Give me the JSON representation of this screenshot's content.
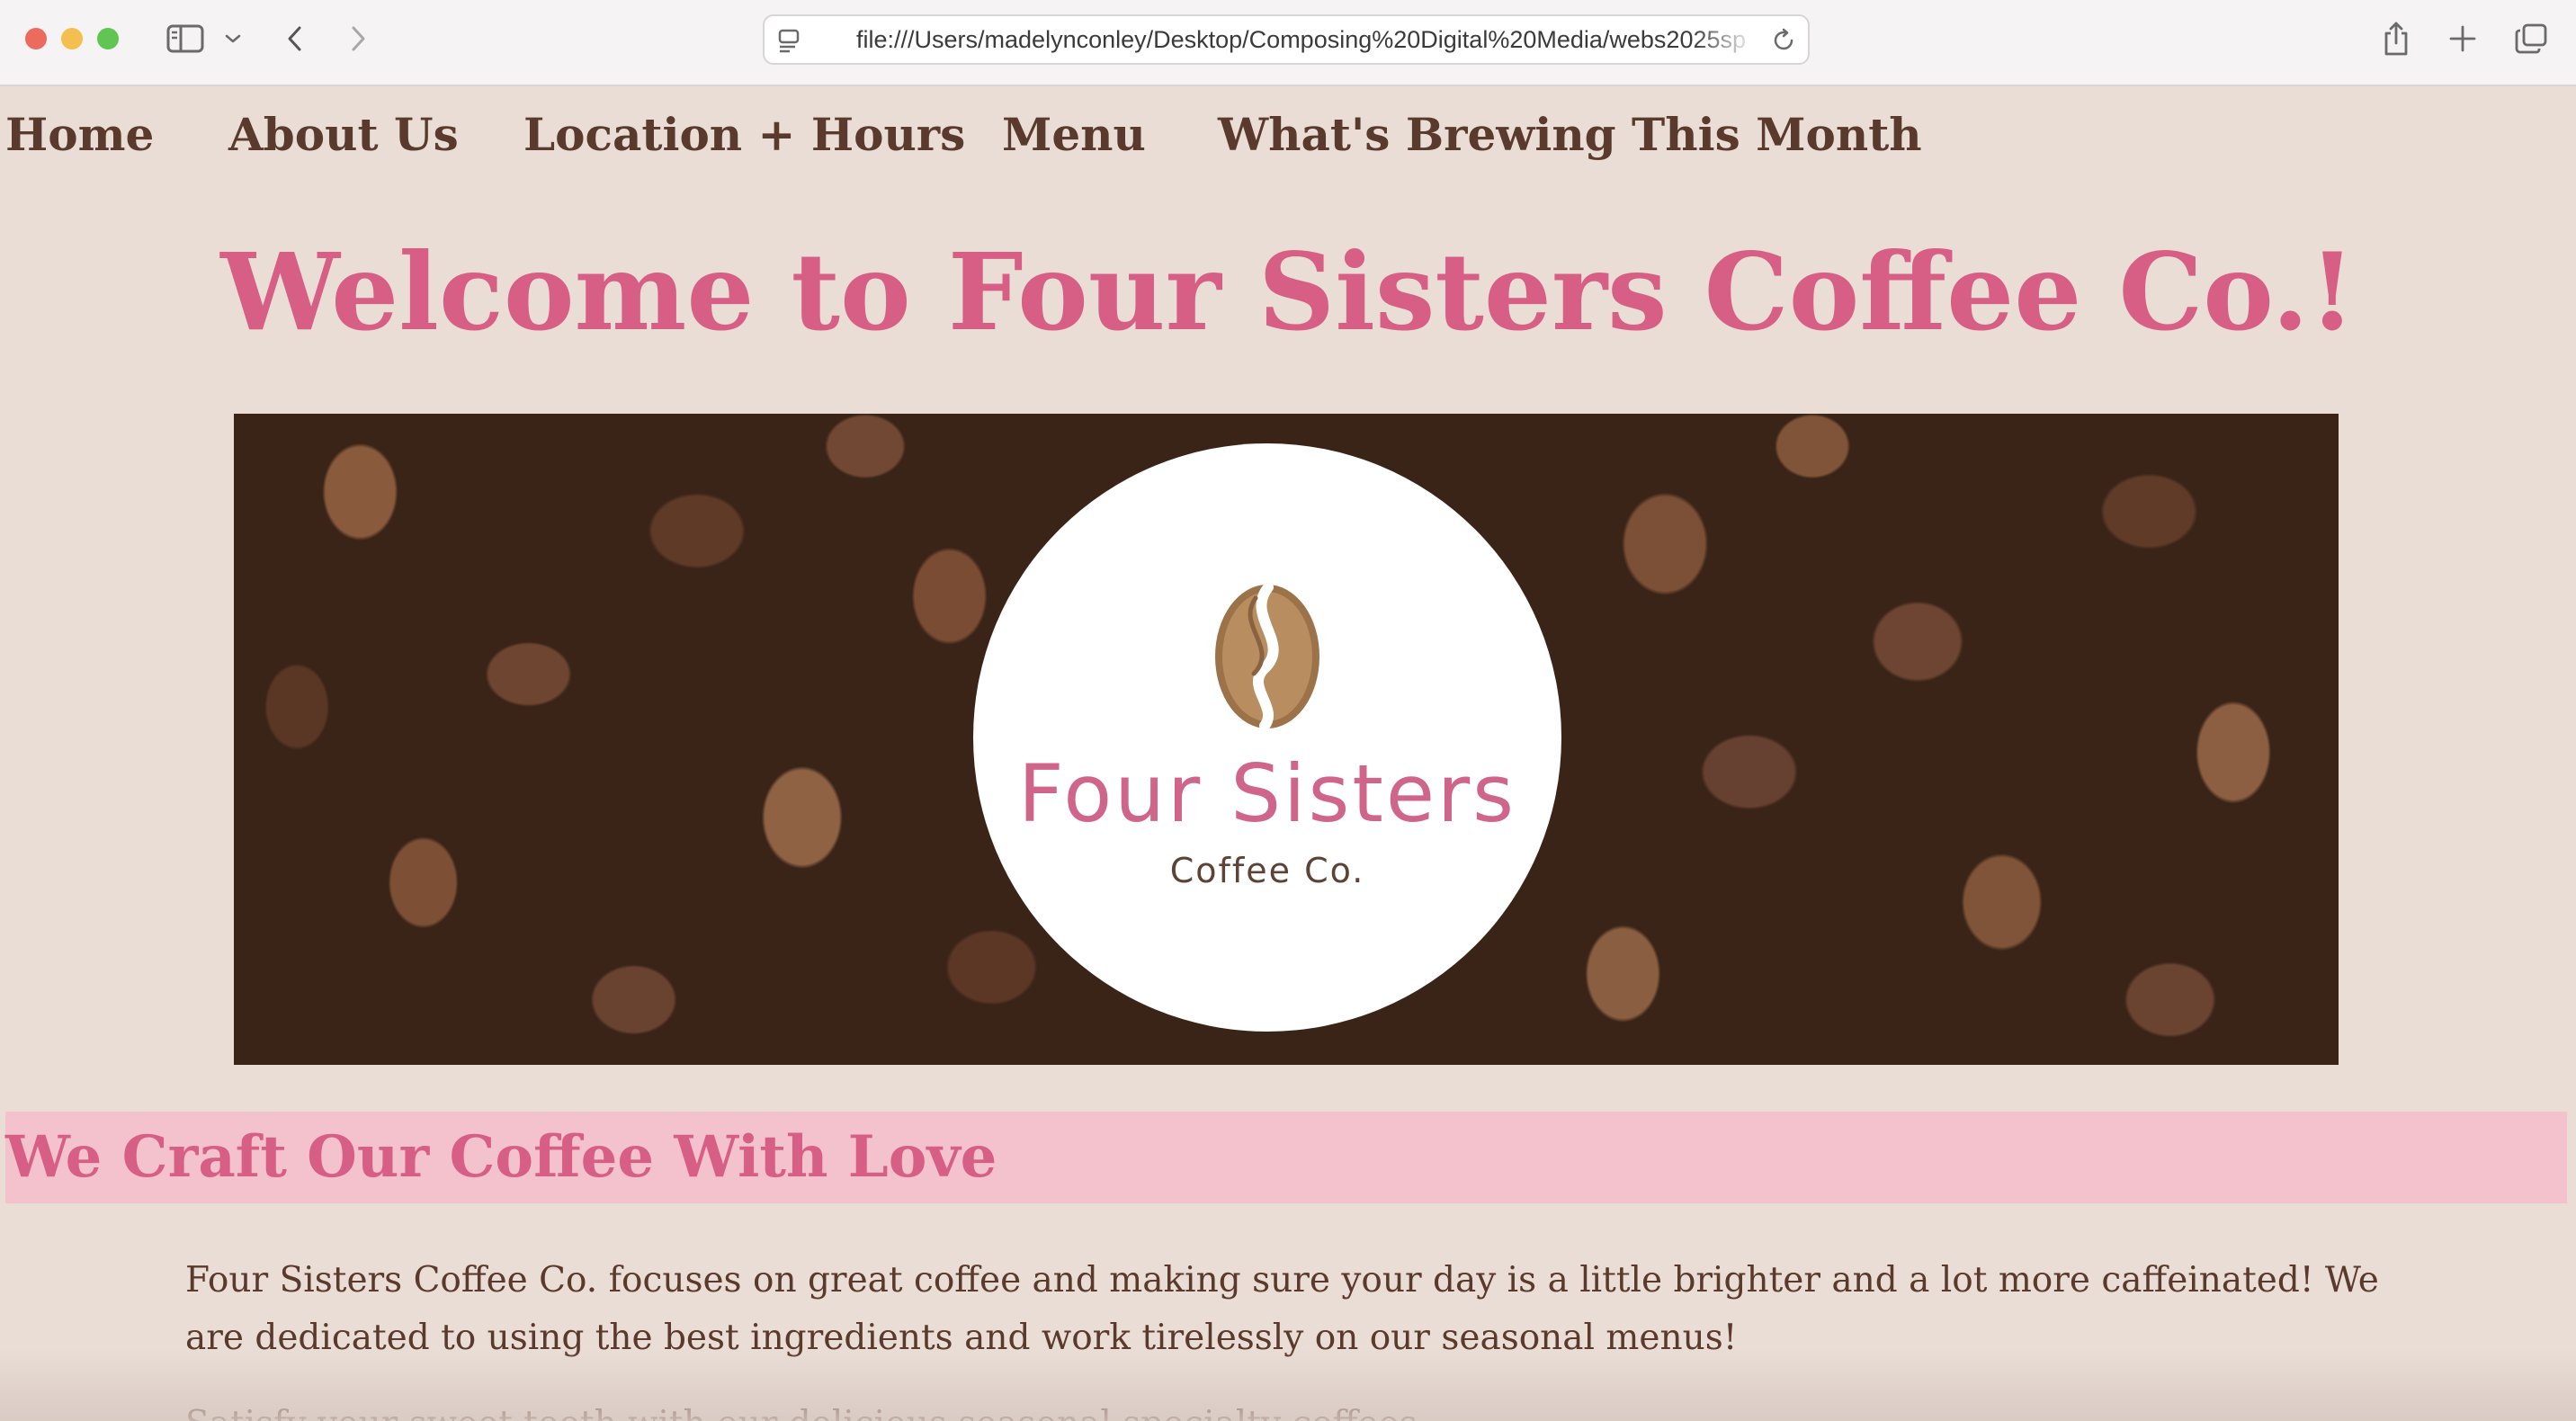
{
  "browser": {
    "url": "file:///Users/madelynconley/Desktop/Composing%20Digital%20Media/webs2025sp"
  },
  "nav": {
    "items": [
      "Home",
      "About Us",
      "Location + Hours",
      "Menu",
      "What's Brewing This Month"
    ]
  },
  "hero": {
    "title": "Welcome to Four Sisters Coffee Co.!"
  },
  "logo": {
    "name": "Four Sisters",
    "subtitle": "Coffee Co."
  },
  "section": {
    "heading": "We Craft Our Coffee With Love",
    "paragraph": "Four Sisters Coffee Co. focuses on great coffee and making sure your day is a little brighter and a lot more caffeinated! We are dedicated to using the best ingredients and work tirelessly on our seasonal menus!",
    "paragraph_2": "Satisfy your sweet tooth with our delicious seasonal specialty coffees."
  },
  "colors": {
    "background": "#e9ddd5",
    "accent_pink": "#d75f86",
    "section_pink": "#f4c2cd",
    "text_brown": "#5a3a2c"
  }
}
